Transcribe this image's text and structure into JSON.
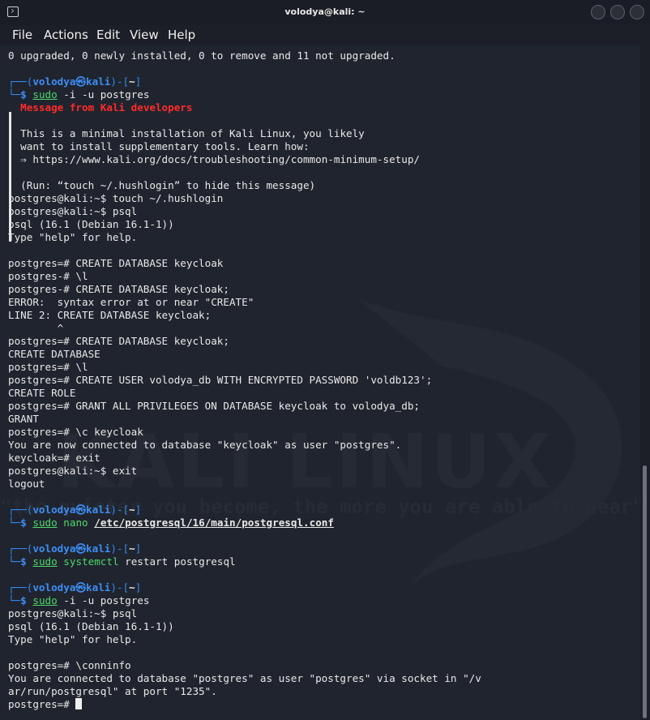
{
  "window": {
    "title": "volodya@kali: ~"
  },
  "menu": {
    "items": [
      "File",
      "Actions",
      "Edit",
      "View",
      "Help"
    ]
  },
  "background": {
    "watermark": "KALI LINUX",
    "slogan": "\"the quieter you become, the more you are able to hear\""
  },
  "prompt": {
    "user": "volodya",
    "host": "kali",
    "dir": "~",
    "symbol": "$"
  },
  "terminal": {
    "l00": "0 upgraded, 0 newly installed, 0 to remove and 11 not upgraded.",
    "p1": {
      "cmd": "sudo",
      "rest": " -i -u postgres"
    },
    "motd_title": "Message from Kali developers",
    "motd1": "This is a minimal installation of Kali Linux, you likely",
    "motd2": "want to install supplementary tools. Learn how:",
    "motd3": "⇒ https://www.kali.org/docs/troubleshooting/common-minimum-setup/",
    "motd_run": "(Run: “touch ~/.hushlogin” to hide this message)",
    "l10": "postgres@kali:~$ touch ~/.hushlogin",
    "l11": "postgres@kali:~$ psql",
    "l12": "psql (16.1 (Debian 16.1-1))",
    "l13": "Type \"help\" for help.",
    "l15": "postgres=# CREATE DATABASE keycloak",
    "l16": "postgres-# \\l",
    "l17": "postgres-# CREATE DATABASE keycloak;",
    "l18": "ERROR:  syntax error at or near \"CREATE\"",
    "l19": "LINE 2: CREATE DATABASE keycloak;",
    "l20": "        ^",
    "l21": "postgres=# CREATE DATABASE keycloak;",
    "l22": "CREATE DATABASE",
    "l23": "postgres=# \\l",
    "l24": "postgres=# CREATE USER volodya_db WITH ENCRYPTED PASSWORD 'voldb123';",
    "l25": "CREATE ROLE",
    "l26": "postgres=# GRANT ALL PRIVILEGES ON DATABASE keycloak to volodya_db;",
    "l27": "GRANT",
    "l28": "postgres=# \\c keycloak",
    "l29": "You are now connected to database \"keycloak\" as user \"postgres\".",
    "l30": "keycloak=# exit",
    "l31": "postgres@kali:~$ exit",
    "l32": "logout",
    "p2": {
      "cmd": "sudo",
      "arg1": "nano",
      "arg2": "/etc/postgresql/16/main/postgresql.conf"
    },
    "p3": {
      "cmd": "sudo",
      "arg1": "systemctl",
      "rest": " restart postgresql"
    },
    "p4": {
      "cmd": "sudo",
      "rest": " -i -u postgres"
    },
    "l46": "postgres@kali:~$ psql",
    "l47": "psql (16.1 (Debian 16.1-1))",
    "l48": "Type \"help\" for help.",
    "l50": "postgres=# \\conninfo",
    "l51": "You are connected to database \"postgres\" as user \"postgres\" via socket in \"/v",
    "l52": "ar/run/postgresql\" at port \"1235\".",
    "l53": "postgres=# "
  },
  "colors": {
    "prompt_blue": "#2f8cf3",
    "motd_red": "#ff2a2a",
    "cmd_green": "#4ed86a"
  }
}
